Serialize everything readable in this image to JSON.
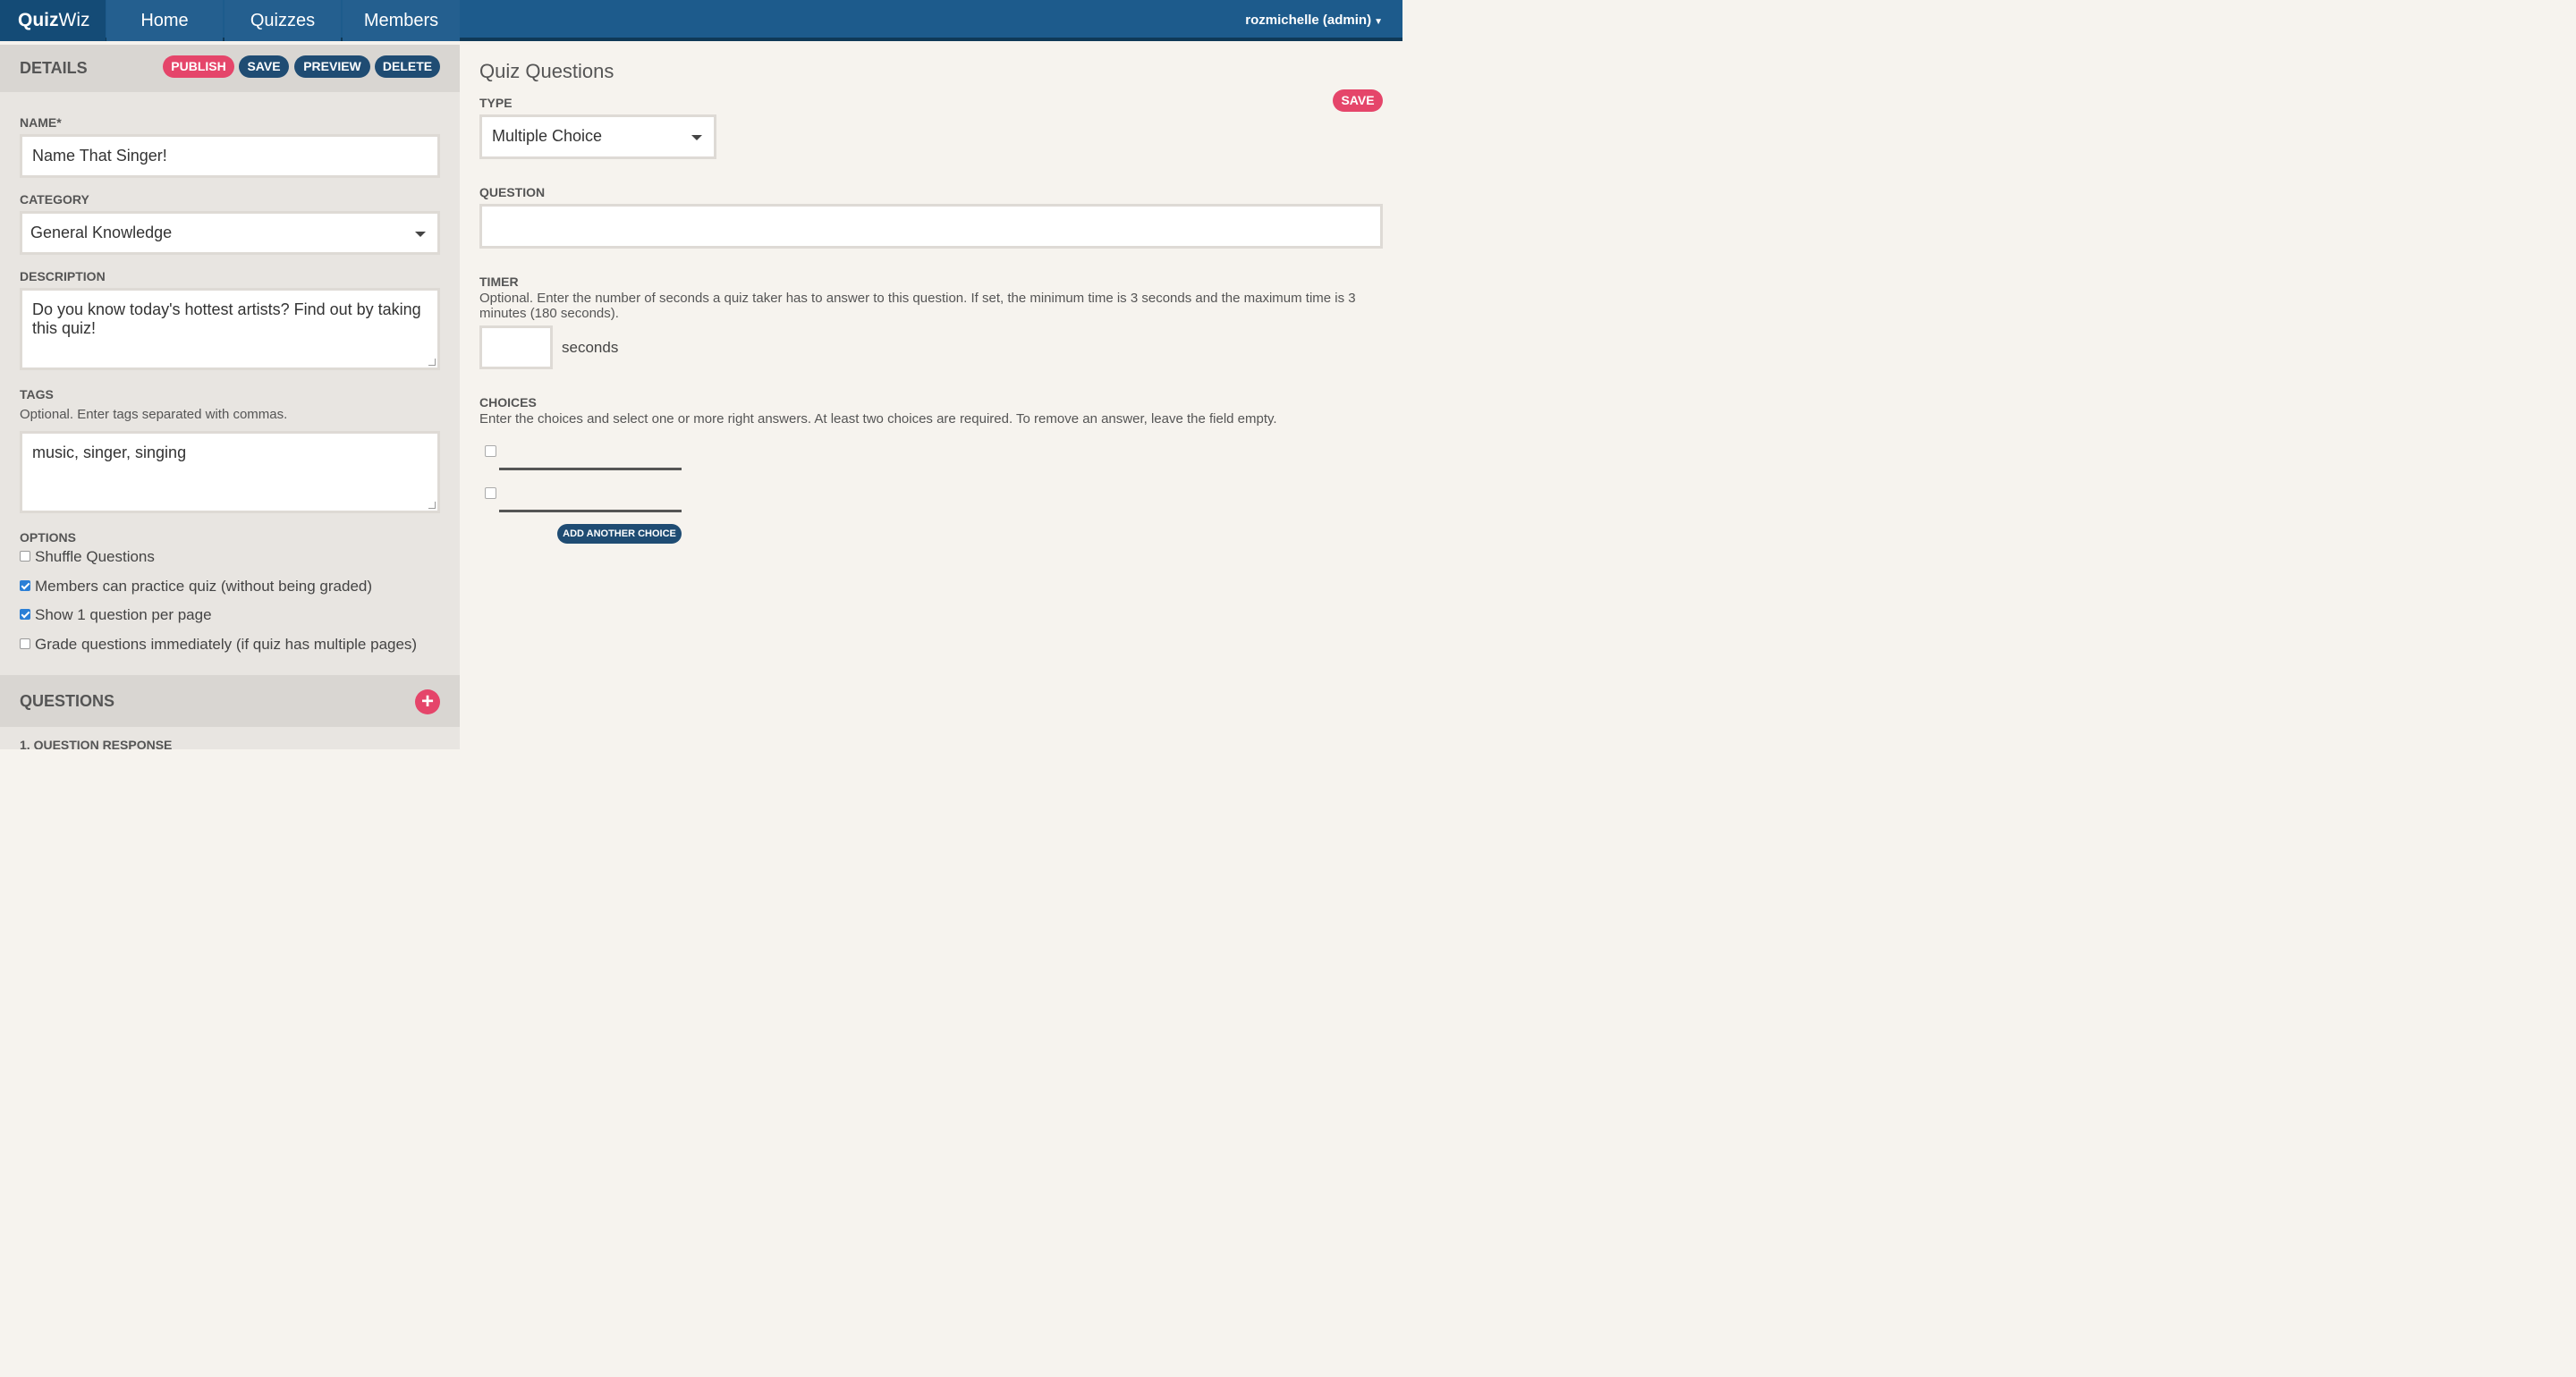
{
  "nav": {
    "logo_bold": "Quiz",
    "logo_light": "Wiz",
    "tabs": [
      "Home",
      "Quizzes",
      "Members"
    ],
    "user": "rozmichelle (admin)",
    "user_caret_icon": "chevron-down-icon"
  },
  "details": {
    "title": "DETAILS",
    "buttons": {
      "publish": "PUBLISH",
      "save": "SAVE",
      "preview": "PREVIEW",
      "delete": "DELETE"
    },
    "name_label": "NAME*",
    "name_value": "Name That Singer!",
    "category_label": "CATEGORY",
    "category_value": "General Knowledge",
    "description_label": "DESCRIPTION",
    "description_value": "Do you know today's hottest artists? Find out by taking this quiz!",
    "tags_label": "TAGS",
    "tags_help": "Optional. Enter tags separated with commas.",
    "tags_value": "music, singer, singing",
    "options_label": "OPTIONS",
    "options": [
      {
        "label": "Shuffle Questions",
        "checked": false
      },
      {
        "label": "Members can practice quiz (without being graded)",
        "checked": true
      },
      {
        "label": "Show 1 question per page",
        "checked": true
      },
      {
        "label": "Grade questions immediately (if quiz has multiple pages)",
        "checked": false
      }
    ]
  },
  "questions": {
    "title": "QUESTIONS",
    "add_icon": "plus-icon",
    "first_item": "1. QUESTION RESPONSE"
  },
  "editor": {
    "title": "Quiz Questions",
    "save": "SAVE",
    "type_label": "TYPE",
    "type_value": "Multiple Choice",
    "question_label": "QUESTION",
    "question_value": "",
    "timer_label": "TIMER",
    "timer_help": "Optional. Enter the number of seconds a quiz taker has to answer to this question. If set, the minimum time is 3 seconds and the maximum time is 3 minutes (180 seconds).",
    "timer_value": "",
    "seconds_label": "seconds",
    "choices_label": "CHOICES",
    "choices_help": "Enter the choices and select one or more right answers. At least two choices are required. To remove an answer, leave the field empty.",
    "choices": [
      {
        "value": "",
        "correct": false
      },
      {
        "value": "",
        "correct": false
      }
    ],
    "add_choice": "ADD ANOTHER CHOICE"
  },
  "colors": {
    "nav_bg": "#1d5b8c",
    "accent_pink": "#e5456a",
    "accent_navy": "#1f4c73",
    "checkbox_blue": "#2b7fd6"
  }
}
